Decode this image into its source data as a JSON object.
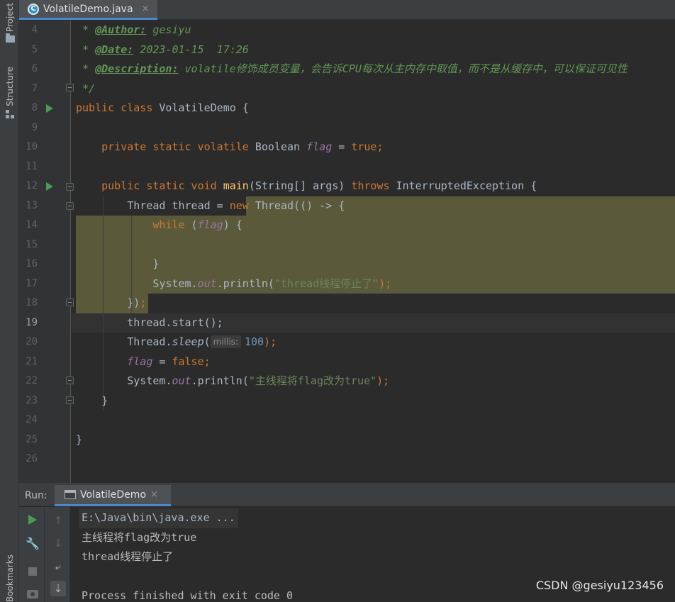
{
  "sidebar": {
    "project_label": "Project",
    "structure_label": "Structure",
    "bookmarks_label": "Bookmarks"
  },
  "editor_tab": {
    "filename": "VolatileDemo.java",
    "icon": "C",
    "close": "×"
  },
  "editor": {
    "line_numbers": [
      "4",
      "5",
      "6",
      "7",
      "8",
      "9",
      "10",
      "11",
      "12",
      "13",
      "14",
      "15",
      "16",
      "17",
      "18",
      "19",
      "20",
      "21",
      "22",
      "23",
      "24",
      "25",
      "26"
    ],
    "current_line": "19",
    "doc": {
      "author_prefix": " * ",
      "author_tag": "@Author:",
      "author_value": " gesiyu",
      "date_prefix": " * ",
      "date_tag": "@Date:",
      "date_value": " 2023-01-15  17:26",
      "desc_prefix": " * ",
      "desc_tag": "@Description:",
      "desc_value": " volatile修饰成员变量，会告诉CPU每次从主内存中取值，而不是从缓存中，可以保证可见性",
      "end": " */"
    },
    "class_decl": {
      "kw_public": "public",
      "kw_class": "class",
      "name": "VolatileDemo",
      "brace": "{"
    },
    "field_decl": {
      "kw": "private static volatile",
      "type": "Boolean",
      "name": "flag",
      "assign": "=",
      "value": "true",
      "semi": ";"
    },
    "main_decl": {
      "kw": "public static void",
      "name": "main",
      "params": "(String[] args)",
      "kw_throws": "throws",
      "exc": "InterruptedException {"
    },
    "line13": {
      "prefix": "Thread thread = ",
      "kw_new": "new",
      "rest": " Thread(() -> {"
    },
    "line14": {
      "kw_while": "while",
      "open": " (",
      "flag": "flag",
      "close": ") {"
    },
    "line16": {
      "text": "}"
    },
    "line17": {
      "sys": "System.",
      "out": "out",
      "method": ".println(",
      "str": "\"thread线程停止了\"",
      "end": ");"
    },
    "line18": {
      "close": "})",
      "semi": ";"
    },
    "line19": {
      "text": "thread.start();"
    },
    "line20": {
      "prefix": "Thread.",
      "method": "sleep",
      "paren": "(",
      "hint": "millis:",
      "num": "100",
      "end": ");"
    },
    "line21": {
      "flag": "flag",
      "assign": " = ",
      "value": "false",
      "semi": ";"
    },
    "line22": {
      "sys": "System.",
      "out": "out",
      "method": ".println(",
      "str": "\"主线程将flag改为true\"",
      "end": ");"
    },
    "line23": {
      "text": "}"
    },
    "line25": {
      "text": "}"
    }
  },
  "run_panel": {
    "label": "Run:",
    "tab_label": "VolatileDemo",
    "tab_close": "×",
    "output": [
      "E:\\Java\\bin\\java.exe ...",
      "主线程将flag改为true",
      "thread线程停止了",
      "",
      "Process finished with exit code 0"
    ],
    "tools": {
      "rerun": "▶",
      "settings": "🔧",
      "up": "↑",
      "down": "↓",
      "soft_wrap": "⤶",
      "scroll_end": "⇣"
    }
  },
  "watermark": "CSDN @gesiyu123456",
  "colors": {
    "background": "#2b2b2b",
    "keyword": "#cc7832",
    "string": "#6a8759",
    "number": "#6897bb",
    "field": "#9876aa",
    "doc_comment": "#629755",
    "highlight": "#5a5a3a",
    "run_green": "#499c54"
  }
}
